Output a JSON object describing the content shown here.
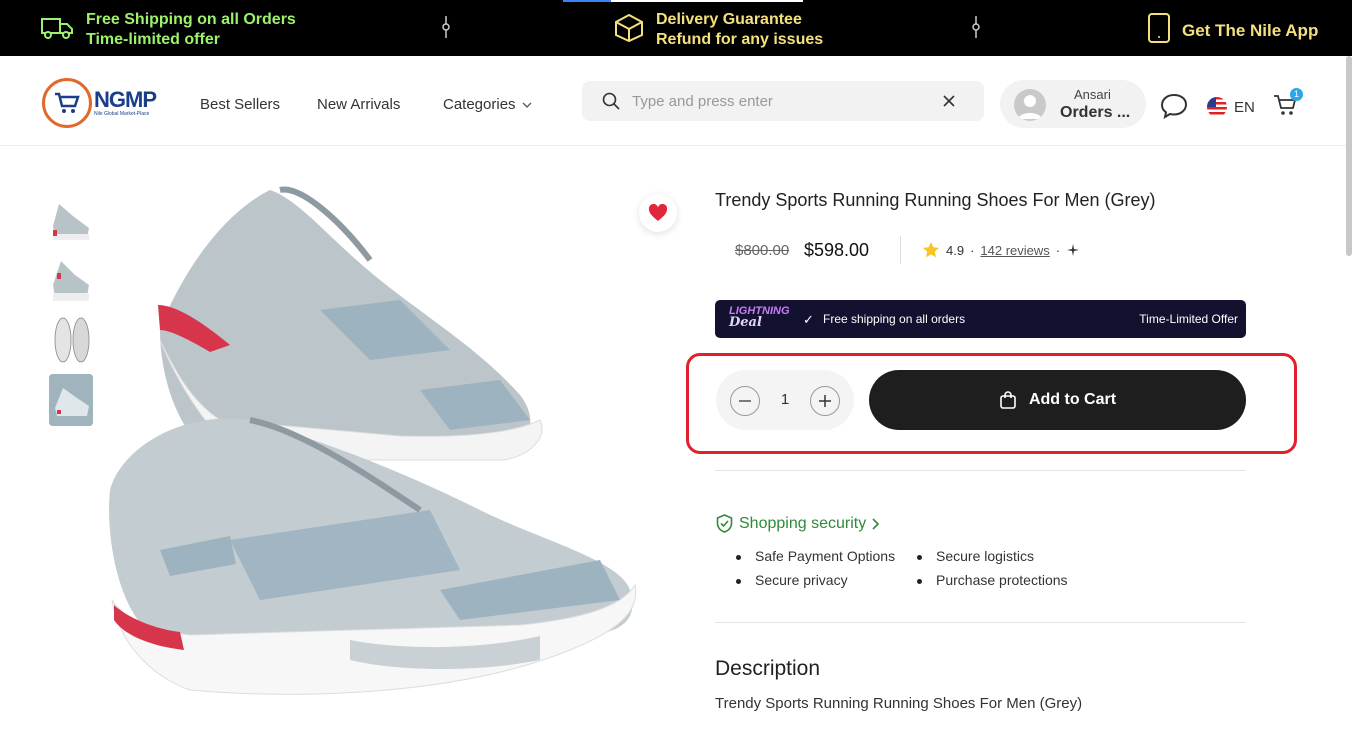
{
  "promo": {
    "shipping_line1": "Free Shipping on all Orders",
    "shipping_line2": "Time-limited offer",
    "delivery_line1": "Delivery Guarantee",
    "delivery_line2": "Refund for any issues",
    "app_label": "Get The Nile App"
  },
  "header": {
    "logo_text": "NGMP",
    "logo_sub": "Nile Global Market-Place",
    "nav": {
      "best_sellers": "Best Sellers",
      "new_arrivals": "New Arrivals",
      "categories": "Categories"
    },
    "search_placeholder": "Type and press enter",
    "account_name": "Ansari",
    "account_orders": "Orders ...",
    "language": "EN",
    "cart_count": "1"
  },
  "product": {
    "title": "Trendy Sports Running Running Shoes For Men (Grey)",
    "old_price": "$800.00",
    "price": "$598.00",
    "rating": "4.9",
    "reviews": "142 reviews",
    "thumbnails_count": 4
  },
  "deal": {
    "logo_line1": "LIGHTNING",
    "logo_line2": "Deal",
    "free_shipping": "Free shipping on all orders",
    "limited": "Time-Limited Offer"
  },
  "purchase": {
    "quantity": "1",
    "add_to_cart": "Add to Cart"
  },
  "security": {
    "title": "Shopping security",
    "items": [
      "Safe Payment Options",
      "Secure logistics",
      "Secure privacy",
      "Purchase protections"
    ]
  },
  "description": {
    "heading": "Description",
    "body": "Trendy Sports Running Running Shoes For Men (Grey)"
  },
  "colors": {
    "promo_green": "#9df26b",
    "promo_yellow": "#f4e07c",
    "highlight_red": "#e0202b",
    "security_green": "#2f8a3b",
    "cart_button": "#1e1e1e"
  }
}
